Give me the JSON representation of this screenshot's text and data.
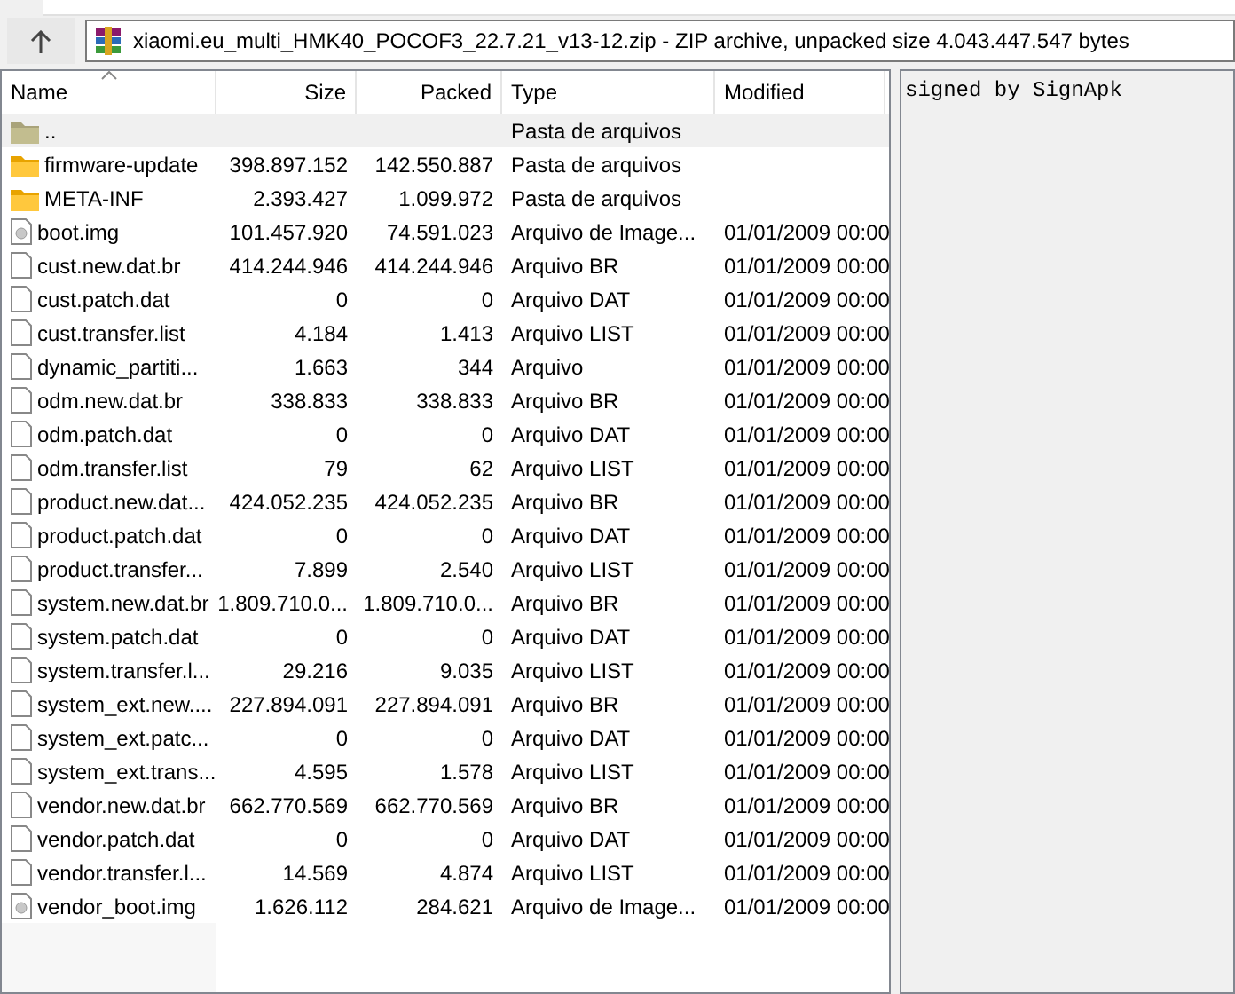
{
  "address": {
    "path": "xiaomi.eu_multi_HMK40_POCOF3_22.7.21_v13-12.zip - ZIP archive, unpacked size 4.043.447.547 bytes"
  },
  "table": {
    "columns": [
      {
        "label": "Name",
        "sorted": true
      },
      {
        "label": "Size",
        "sorted": false
      },
      {
        "label": "Packed",
        "sorted": false
      },
      {
        "label": "Type",
        "sorted": false
      },
      {
        "label": "Modified",
        "sorted": false
      }
    ],
    "rows": [
      {
        "kind": "parent",
        "name": "..",
        "size": "",
        "packed": "",
        "type": "Pasta de arquivos",
        "modified": "",
        "selected": true
      },
      {
        "kind": "folder",
        "name": "firmware-update",
        "size": "398.897.152",
        "packed": "142.550.887",
        "type": "Pasta de arquivos",
        "modified": "",
        "selected": false
      },
      {
        "kind": "folder",
        "name": "META-INF",
        "size": "2.393.427",
        "packed": "1.099.972",
        "type": "Pasta de arquivos",
        "modified": "",
        "selected": false
      },
      {
        "kind": "image",
        "name": "boot.img",
        "size": "101.457.920",
        "packed": "74.591.023",
        "type": "Arquivo de Image...",
        "modified": "01/01/2009 00:00",
        "selected": false
      },
      {
        "kind": "file",
        "name": "cust.new.dat.br",
        "size": "414.244.946",
        "packed": "414.244.946",
        "type": "Arquivo BR",
        "modified": "01/01/2009 00:00",
        "selected": false
      },
      {
        "kind": "file",
        "name": "cust.patch.dat",
        "size": "0",
        "packed": "0",
        "type": "Arquivo DAT",
        "modified": "01/01/2009 00:00",
        "selected": false
      },
      {
        "kind": "file",
        "name": "cust.transfer.list",
        "size": "4.184",
        "packed": "1.413",
        "type": "Arquivo LIST",
        "modified": "01/01/2009 00:00",
        "selected": false
      },
      {
        "kind": "file",
        "name": "dynamic_partiti...",
        "size": "1.663",
        "packed": "344",
        "type": "Arquivo",
        "modified": "01/01/2009 00:00",
        "selected": false
      },
      {
        "kind": "file",
        "name": "odm.new.dat.br",
        "size": "338.833",
        "packed": "338.833",
        "type": "Arquivo BR",
        "modified": "01/01/2009 00:00",
        "selected": false
      },
      {
        "kind": "file",
        "name": "odm.patch.dat",
        "size": "0",
        "packed": "0",
        "type": "Arquivo DAT",
        "modified": "01/01/2009 00:00",
        "selected": false
      },
      {
        "kind": "file",
        "name": "odm.transfer.list",
        "size": "79",
        "packed": "62",
        "type": "Arquivo LIST",
        "modified": "01/01/2009 00:00",
        "selected": false
      },
      {
        "kind": "file",
        "name": "product.new.dat...",
        "size": "424.052.235",
        "packed": "424.052.235",
        "type": "Arquivo BR",
        "modified": "01/01/2009 00:00",
        "selected": false
      },
      {
        "kind": "file",
        "name": "product.patch.dat",
        "size": "0",
        "packed": "0",
        "type": "Arquivo DAT",
        "modified": "01/01/2009 00:00",
        "selected": false
      },
      {
        "kind": "file",
        "name": "product.transfer...",
        "size": "7.899",
        "packed": "2.540",
        "type": "Arquivo LIST",
        "modified": "01/01/2009 00:00",
        "selected": false
      },
      {
        "kind": "file",
        "name": "system.new.dat.br",
        "size": "1.809.710.0...",
        "packed": "1.809.710.0...",
        "type": "Arquivo BR",
        "modified": "01/01/2009 00:00",
        "selected": false
      },
      {
        "kind": "file",
        "name": "system.patch.dat",
        "size": "0",
        "packed": "0",
        "type": "Arquivo DAT",
        "modified": "01/01/2009 00:00",
        "selected": false
      },
      {
        "kind": "file",
        "name": "system.transfer.l...",
        "size": "29.216",
        "packed": "9.035",
        "type": "Arquivo LIST",
        "modified": "01/01/2009 00:00",
        "selected": false
      },
      {
        "kind": "file",
        "name": "system_ext.new....",
        "size": "227.894.091",
        "packed": "227.894.091",
        "type": "Arquivo BR",
        "modified": "01/01/2009 00:00",
        "selected": false
      },
      {
        "kind": "file",
        "name": "system_ext.patc...",
        "size": "0",
        "packed": "0",
        "type": "Arquivo DAT",
        "modified": "01/01/2009 00:00",
        "selected": false
      },
      {
        "kind": "file",
        "name": "system_ext.trans...",
        "size": "4.595",
        "packed": "1.578",
        "type": "Arquivo LIST",
        "modified": "01/01/2009 00:00",
        "selected": false
      },
      {
        "kind": "file",
        "name": "vendor.new.dat.br",
        "size": "662.770.569",
        "packed": "662.770.569",
        "type": "Arquivo BR",
        "modified": "01/01/2009 00:00",
        "selected": false
      },
      {
        "kind": "file",
        "name": "vendor.patch.dat",
        "size": "0",
        "packed": "0",
        "type": "Arquivo DAT",
        "modified": "01/01/2009 00:00",
        "selected": false
      },
      {
        "kind": "file",
        "name": "vendor.transfer.l...",
        "size": "14.569",
        "packed": "4.874",
        "type": "Arquivo LIST",
        "modified": "01/01/2009 00:00",
        "selected": false
      },
      {
        "kind": "image",
        "name": "vendor_boot.img",
        "size": "1.626.112",
        "packed": "284.621",
        "type": "Arquivo de Image...",
        "modified": "01/01/2009 00:00",
        "selected": false
      }
    ]
  },
  "comment": {
    "text": "signed by SignApk"
  }
}
